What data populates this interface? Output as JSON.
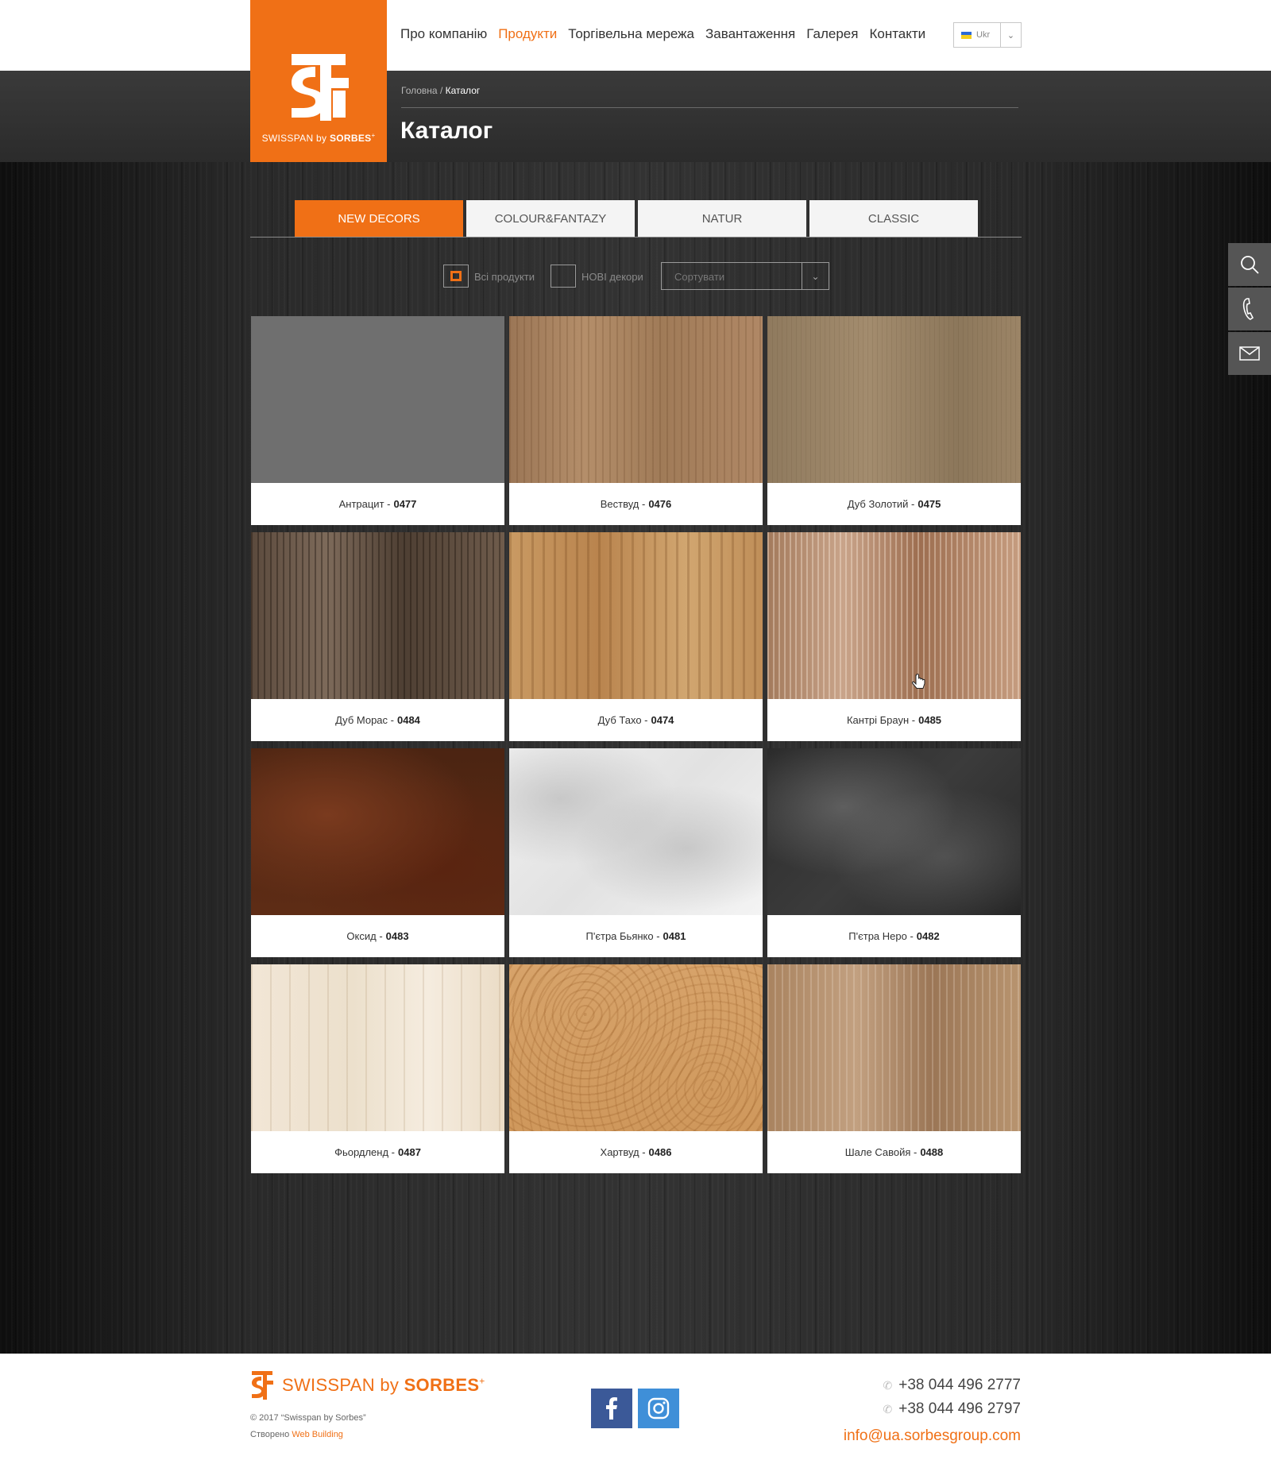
{
  "brand": {
    "logo_caption_prefix": "SWISSPAN by",
    "logo_caption_bold": "SORBES",
    "accent_color": "#f07016"
  },
  "nav": {
    "items": [
      "Про компанію",
      "Продукти",
      "Торгівельна мережа",
      "Завантаження",
      "Галерея",
      "Контакти"
    ],
    "active": "Продукти"
  },
  "language": {
    "label": "Ukr",
    "icon": "chevron-down-icon"
  },
  "breadcrumb": {
    "home": "Головна",
    "separator": "/",
    "current": "Каталог"
  },
  "page_title": "Каталог",
  "tabs": [
    {
      "label": "NEW DECORS",
      "active": true
    },
    {
      "label": "COLOUR&FANTAZY",
      "active": false
    },
    {
      "label": "NATUR",
      "active": false
    },
    {
      "label": "CLASSIC",
      "active": false
    }
  ],
  "filters": {
    "all_products": {
      "label": "Всі продукти",
      "checked": true
    },
    "new_decors": {
      "label": "НОВІ декори",
      "checked": false
    },
    "sort": {
      "placeholder": "Сортувати"
    }
  },
  "products": [
    {
      "name": "Антрацит -",
      "code": "0477"
    },
    {
      "name": "Вествуд -",
      "code": "0476"
    },
    {
      "name": "Дуб Золотий -",
      "code": "0475"
    },
    {
      "name": "Дуб Морас -",
      "code": "0484"
    },
    {
      "name": "Дуб Тахо -",
      "code": "0474"
    },
    {
      "name": "Кантрі Браун -",
      "code": "0485"
    },
    {
      "name": "Оксид -",
      "code": "0483"
    },
    {
      "name": "П'єтра Бьянко -",
      "code": "0481"
    },
    {
      "name": "П'єтра Неро -",
      "code": "0482"
    },
    {
      "name": "Фьордленд -",
      "code": "0487"
    },
    {
      "name": "Хартвуд -",
      "code": "0486"
    },
    {
      "name": "Шале Савойя -",
      "code": "0488"
    }
  ],
  "side_widgets": [
    "search-icon",
    "phone-icon",
    "mail-icon"
  ],
  "footer": {
    "brand_prefix": "SWISSPAN by",
    "brand_bold": "SORBES",
    "copyright": "© 2017 “Swisspan by Sorbes”",
    "created_prefix": "Створено",
    "created_link": "Web Building",
    "phones": [
      "+38 044 496 2777",
      "+38 044 496 2797"
    ],
    "email": "info@ua.sorbesgroup.com",
    "facebook_color": "#3b5998",
    "instagram_color": "#3f8fd8"
  }
}
